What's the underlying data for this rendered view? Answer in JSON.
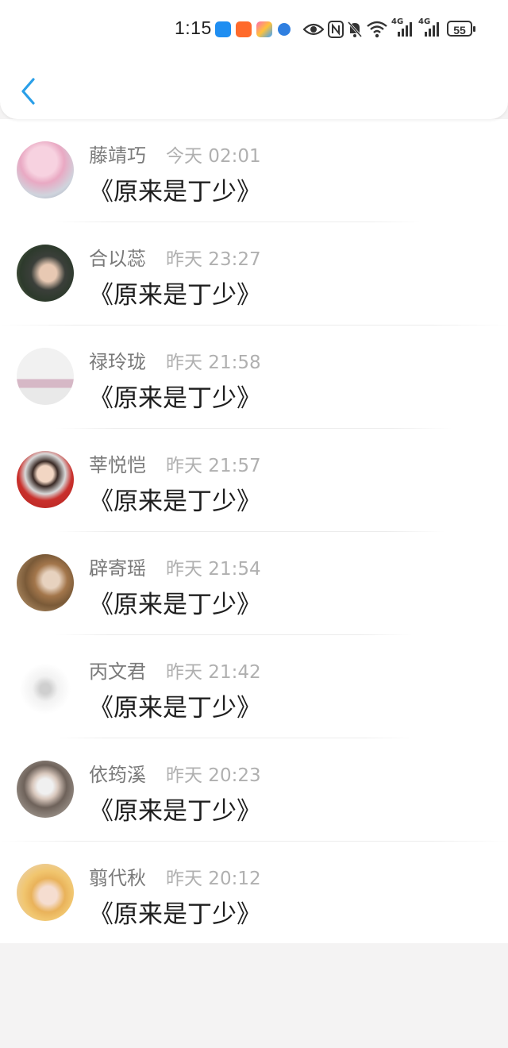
{
  "status_bar": {
    "time": "1:15",
    "network_1": "4G",
    "network_2": "4G",
    "battery": "55"
  },
  "header": {
    "back_icon": "chevron-left-icon"
  },
  "colors": {
    "accent": "#2a9fe8"
  },
  "comments": [
    {
      "name": "藤靖巧",
      "time": "今天 02:01",
      "text": "《原来是丁少》"
    },
    {
      "name": "合以蕊",
      "time": "昨天 23:27",
      "text": "《原来是丁少》"
    },
    {
      "name": "禄玲珑",
      "time": "昨天 21:58",
      "text": "《原来是丁少》"
    },
    {
      "name": "莘悦恺",
      "time": "昨天 21:57",
      "text": "《原来是丁少》"
    },
    {
      "name": "辟寄瑶",
      "time": "昨天 21:54",
      "text": "《原来是丁少》"
    },
    {
      "name": "丙文君",
      "time": "昨天 21:42",
      "text": "《原来是丁少》"
    },
    {
      "name": "依筠溪",
      "time": "昨天 20:23",
      "text": "《原来是丁少》"
    },
    {
      "name": "翦代秋",
      "time": "昨天 20:12",
      "text": "《原来是丁少》"
    }
  ]
}
